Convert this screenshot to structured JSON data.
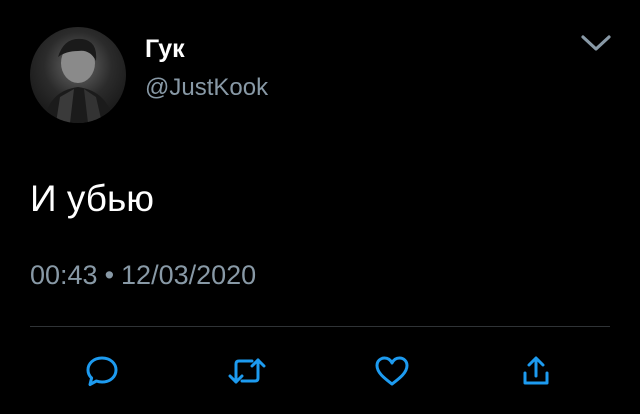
{
  "author": {
    "display_name": "Гук",
    "handle": "@JustKook",
    "avatar_icon": "user-avatar-photo"
  },
  "tweet": {
    "text": "И убью",
    "time": "00:43",
    "separator": "•",
    "date": "12/03/2020"
  },
  "actions": [
    {
      "name": "reply",
      "icon": "speech-bubble-icon"
    },
    {
      "name": "retweet",
      "icon": "retweet-arrows-icon"
    },
    {
      "name": "like",
      "icon": "heart-icon"
    },
    {
      "name": "share",
      "icon": "share-upload-icon"
    }
  ],
  "colors": {
    "background": "#000000",
    "primary_text": "#ffffff",
    "secondary_text": "#8899a6",
    "divider": "#2f3336",
    "action_icon": "#1d9bf0"
  }
}
